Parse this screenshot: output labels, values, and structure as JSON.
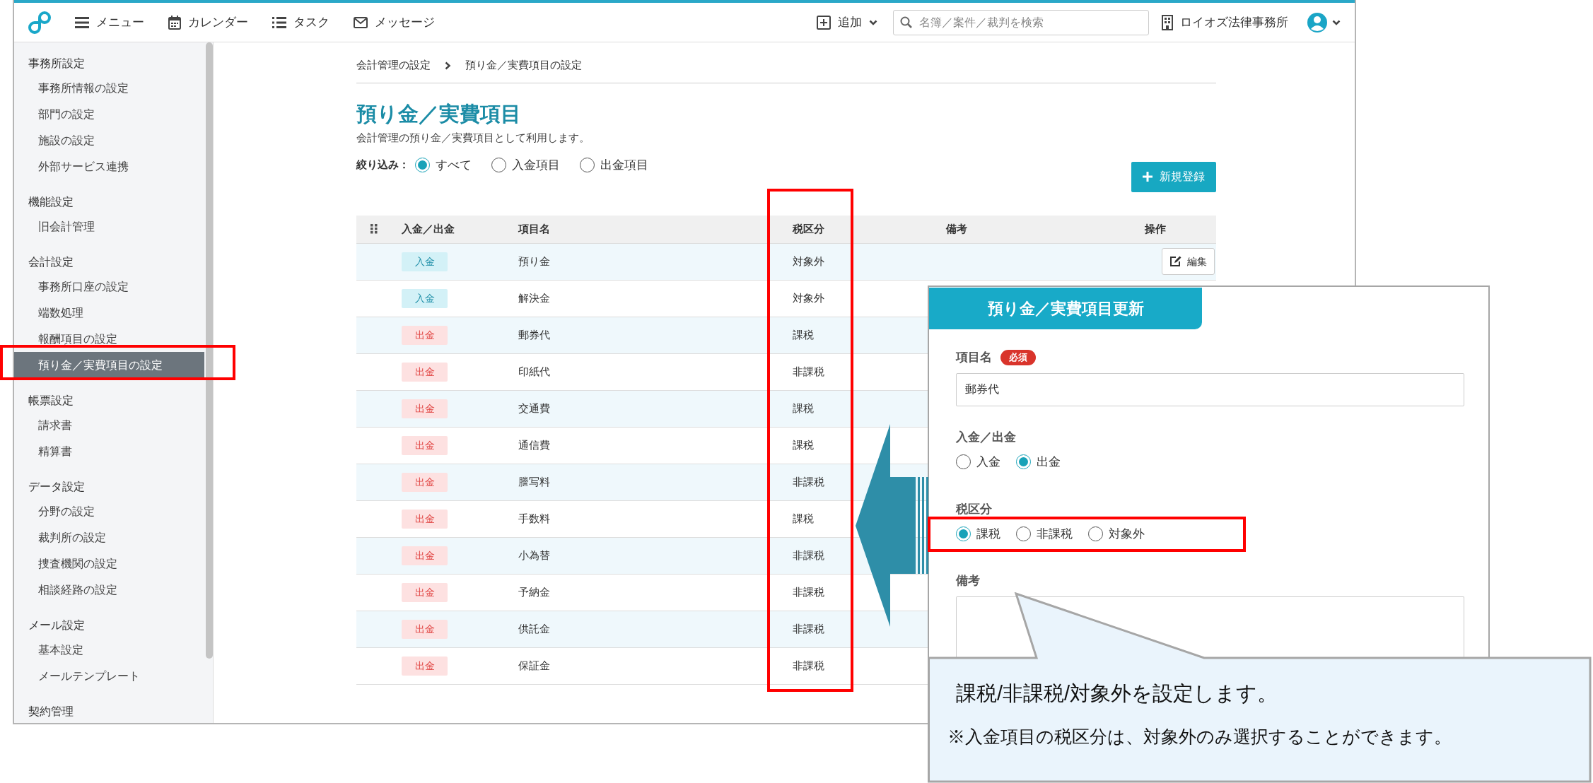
{
  "topbar": {
    "menu": [
      {
        "kind": "menu",
        "label": "メニュー"
      },
      {
        "kind": "calendar",
        "label": "カレンダー"
      },
      {
        "kind": "tasks",
        "label": "タスク"
      },
      {
        "kind": "messages",
        "label": "メッセージ"
      }
    ],
    "add_button": "追加",
    "search": {
      "placeholder": "名簿／案件／裁判を検索"
    },
    "office": "ロイオズ法律事務所"
  },
  "sidebar": {
    "sections": [
      {
        "title": "事務所設定",
        "items": [
          {
            "label": "事務所情報の設定",
            "selected": false
          },
          {
            "label": "部門の設定",
            "selected": false
          },
          {
            "label": "施設の設定",
            "selected": false
          },
          {
            "label": "外部サービス連携",
            "selected": false
          }
        ]
      },
      {
        "title": "機能設定",
        "items": [
          {
            "label": "旧会計管理",
            "selected": false
          }
        ]
      },
      {
        "title": "会計設定",
        "items": [
          {
            "label": "事務所口座の設定",
            "selected": false
          },
          {
            "label": "端数処理",
            "selected": false
          },
          {
            "label": "報酬項目の設定",
            "selected": false
          },
          {
            "label": "預り金／実費項目の設定",
            "selected": true
          }
        ]
      },
      {
        "title": "帳票設定",
        "items": [
          {
            "label": "請求書",
            "selected": false
          },
          {
            "label": "精算書",
            "selected": false
          }
        ]
      },
      {
        "title": "データ設定",
        "items": [
          {
            "label": "分野の設定",
            "selected": false
          },
          {
            "label": "裁判所の設定",
            "selected": false
          },
          {
            "label": "捜査機関の設定",
            "selected": false
          },
          {
            "label": "相談経路の設定",
            "selected": false
          }
        ]
      },
      {
        "title": "メール設定",
        "items": [
          {
            "label": "基本設定",
            "selected": false
          },
          {
            "label": "メールテンプレート",
            "selected": false
          }
        ]
      },
      {
        "title": "契約管理"
      }
    ]
  },
  "breadcrumb": [
    "会計管理の設定",
    "預り金／実費項目の設定"
  ],
  "page": {
    "title": "預り金／実費項目",
    "subtitle": "会計管理の預り金／実費項目として利用します。"
  },
  "filter": {
    "label": "絞り込み：",
    "options": [
      {
        "label": "すべて",
        "selected": true
      },
      {
        "label": "入金項目",
        "selected": false
      },
      {
        "label": "出金項目",
        "selected": false
      }
    ]
  },
  "new_button": "新規登録",
  "table": {
    "columns": [
      "入金／出金",
      "項目名",
      "税区分",
      "備考",
      "操作"
    ],
    "rows": [
      {
        "kind": "deposit",
        "type": "入金",
        "name": "預り金",
        "tax": "対象外",
        "edit": "編集"
      },
      {
        "kind": "deposit",
        "type": "入金",
        "name": "解決金",
        "tax": "対象外"
      },
      {
        "kind": "withdrawal",
        "type": "出金",
        "name": "郵券代",
        "tax": "課税"
      },
      {
        "kind": "withdrawal",
        "type": "出金",
        "name": "印紙代",
        "tax": "非課税"
      },
      {
        "kind": "withdrawal",
        "type": "出金",
        "name": "交通費",
        "tax": "課税"
      },
      {
        "kind": "withdrawal",
        "type": "出金",
        "name": "通信費",
        "tax": "課税"
      },
      {
        "kind": "withdrawal",
        "type": "出金",
        "name": "謄写料",
        "tax": "非課税"
      },
      {
        "kind": "withdrawal",
        "type": "出金",
        "name": "手数料",
        "tax": "課税"
      },
      {
        "kind": "withdrawal",
        "type": "出金",
        "name": "小為替",
        "tax": "非課税"
      },
      {
        "kind": "withdrawal",
        "type": "出金",
        "name": "予納金",
        "tax": "非課税"
      },
      {
        "kind": "withdrawal",
        "type": "出金",
        "name": "供託金",
        "tax": "非課税"
      },
      {
        "kind": "withdrawal",
        "type": "出金",
        "name": "保証金",
        "tax": "非課税"
      }
    ]
  },
  "dialog": {
    "title": "預り金／実費項目更新",
    "fields": [
      {
        "kind": "text",
        "label": "項目名",
        "required": "必須",
        "value": "郵券代"
      },
      {
        "kind": "radio",
        "label": "入金／出金",
        "options": [
          {
            "label": "入金",
            "selected": false
          },
          {
            "label": "出金",
            "selected": true
          }
        ]
      },
      {
        "kind": "radio",
        "label": "税区分",
        "options": [
          {
            "label": "課税",
            "selected": true
          },
          {
            "label": "非課税",
            "selected": false
          },
          {
            "label": "対象外",
            "selected": false
          }
        ]
      },
      {
        "kind": "textarea",
        "label": "備考"
      }
    ]
  },
  "callout": {
    "text": "課税/非課税/対象外を設定します。",
    "note": "※入金項目の税区分は、対象外のみ選択することができます。"
  }
}
